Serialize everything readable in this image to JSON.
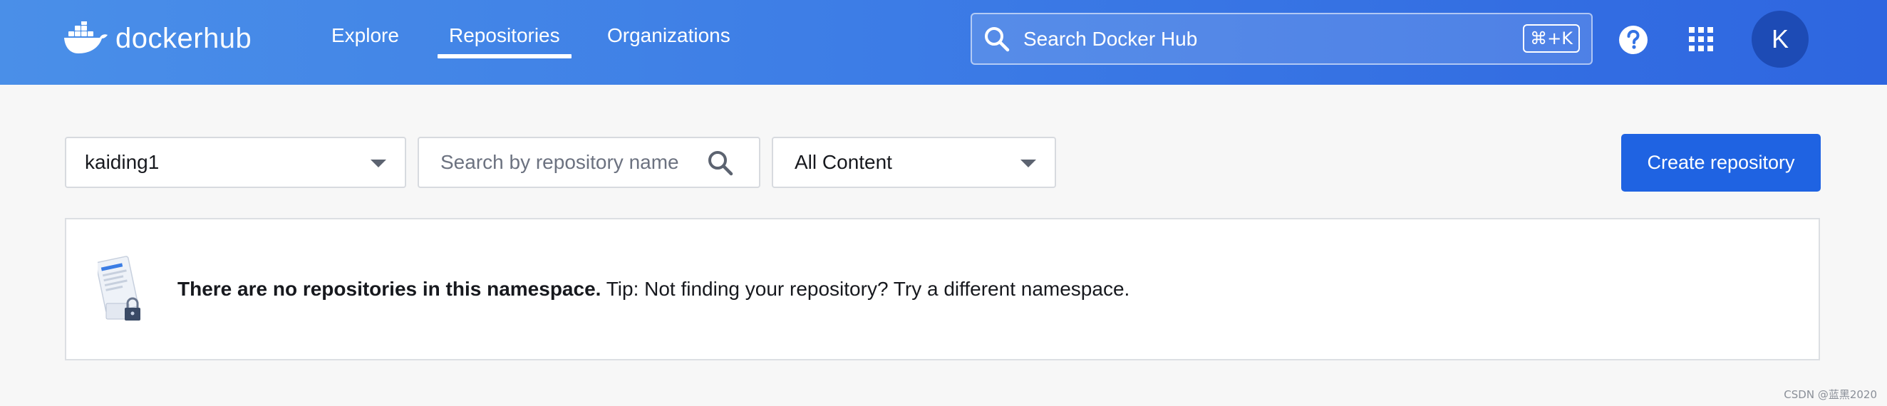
{
  "header": {
    "logo": {
      "brand": "docker",
      "product": "hub",
      "icon": "docker-whale-icon"
    },
    "nav": [
      {
        "label": "Explore",
        "active": false
      },
      {
        "label": "Repositories",
        "active": true
      },
      {
        "label": "Organizations",
        "active": false
      }
    ],
    "search": {
      "placeholder": "Search Docker Hub",
      "shortcut": "⌘+K",
      "icon": "search-icon"
    },
    "help_icon": "help-circle-icon",
    "apps_icon": "grid-apps-icon",
    "avatar_initial": "K"
  },
  "filters": {
    "namespace": {
      "value": "kaiding1",
      "icon": "caret-down-icon"
    },
    "repo_search": {
      "placeholder": "Search by repository name",
      "icon": "search-icon"
    },
    "content": {
      "value": "All Content",
      "icon": "caret-down-icon"
    },
    "create_button": "Create repository"
  },
  "empty_state": {
    "icon": "locked-document-icon",
    "title": "There are no repositories in this namespace.",
    "tip": " Tip: Not finding your repository? Try a different namespace."
  },
  "watermark": "CSDN @蓝黑2020",
  "colors": {
    "header_gradient_start": "#4a8fe8",
    "header_gradient_end": "#2e66e0",
    "primary_button": "#1f63e2",
    "avatar_bg": "#1d4bb5",
    "page_bg": "#f7f7f7"
  }
}
